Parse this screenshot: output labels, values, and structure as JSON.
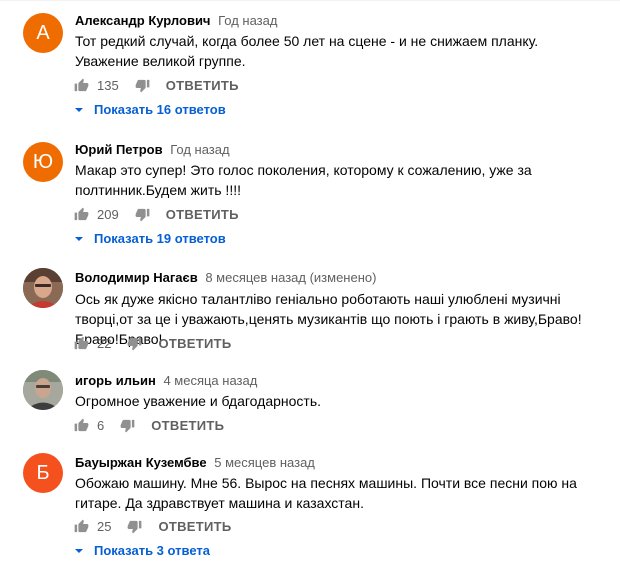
{
  "like_count_label": "",
  "reply_label": "ОТВЕТИТЬ",
  "colors": {
    "accent": "#065fd4",
    "muted": "#606060",
    "orange": "#ef6c00"
  },
  "comments": [
    {
      "author": "Александр Курлович",
      "time": "Год назад",
      "avatar_letter": "А",
      "text": "Тот редкий случай, когда более 50 лет на сцене - и не снижаем планку. Уважение великой группе.",
      "likes": "135",
      "replies_label": "Показать 16 ответов"
    },
    {
      "author": "Юрий Петров",
      "time": "Год назад",
      "avatar_letter": "Ю",
      "text": "Макар это супер! Это голос поколения, которому к сожалению, уже за полтинник.Будем жить !!!!",
      "likes": "209",
      "replies_label": "Показать 19 ответов"
    },
    {
      "author": "Володимир Нагаєв",
      "time": "8 месяцев назад (изменено)",
      "avatar_letter": "",
      "text": "Ось як дуже якісно талантліво геніально роботають наші улюблені музичні творці,от за це і уважають,ценять музикантів що поють і грають в живу,Браво!Браво!Браво!",
      "likes": "22",
      "replies_label": ""
    },
    {
      "author": "игорь ильин",
      "time": "4 месяца назад",
      "avatar_letter": "",
      "text": "Огромное уважение и бдагодарность.",
      "likes": "6",
      "replies_label": ""
    },
    {
      "author": "Бауыржан Кузембве",
      "time": "5 месяцев назад",
      "avatar_letter": "Б",
      "text": "Обожаю машину. Мне 56. Вырос на песнях машины. Почти все песни пою на гитаре. Да здравствует машина и казахстан.",
      "likes": "25",
      "replies_label": "Показать 3 ответа"
    }
  ]
}
